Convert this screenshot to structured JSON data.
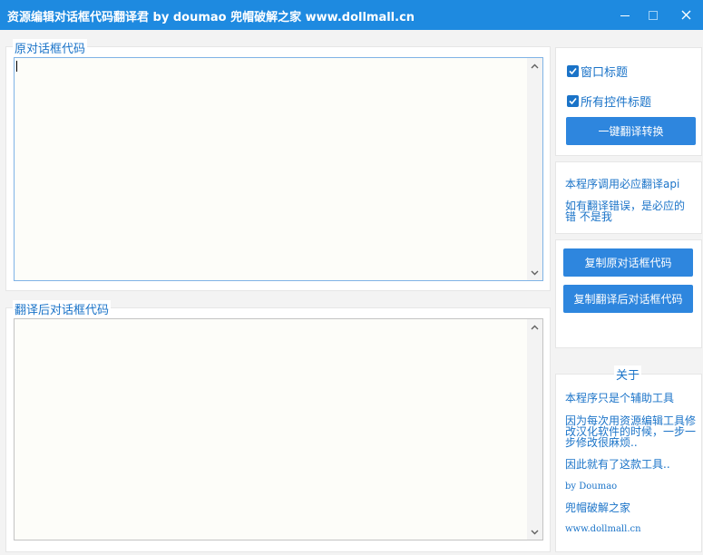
{
  "window": {
    "title": "资源编辑对话框代码翻译君 by doumao 兜帽破解之家 www.dollmall.cn"
  },
  "source_panel": {
    "legend": "原对话框代码",
    "value": ""
  },
  "translated_panel": {
    "legend": "翻译后对话框代码",
    "value": ""
  },
  "options": {
    "window_title_label": "窗口标题",
    "window_title_checked": true,
    "all_controls_label": "所有控件标题",
    "all_controls_checked": true,
    "translate_button": "一键翻译转换"
  },
  "notice": {
    "line1": "本程序调用必应翻译api",
    "line2a": "如有翻译错误，是必应的",
    "line2b": "错 不是我"
  },
  "copy": {
    "copy_source_button": "复制原对话框代码",
    "copy_translated_button": "复制翻译后对话框代码"
  },
  "about": {
    "legend": "关于",
    "line1": "本程序只是个辅助工具",
    "line2a": "因为每次用资源编辑工具修",
    "line2b": "改汉化软件的时候，一步一",
    "line2c": "步修改很麻烦..",
    "line3": "因此就有了这款工具..",
    "line4": "by Doumao",
    "line5": "兜帽破解之家",
    "line6": "www.dollmall.cn"
  }
}
